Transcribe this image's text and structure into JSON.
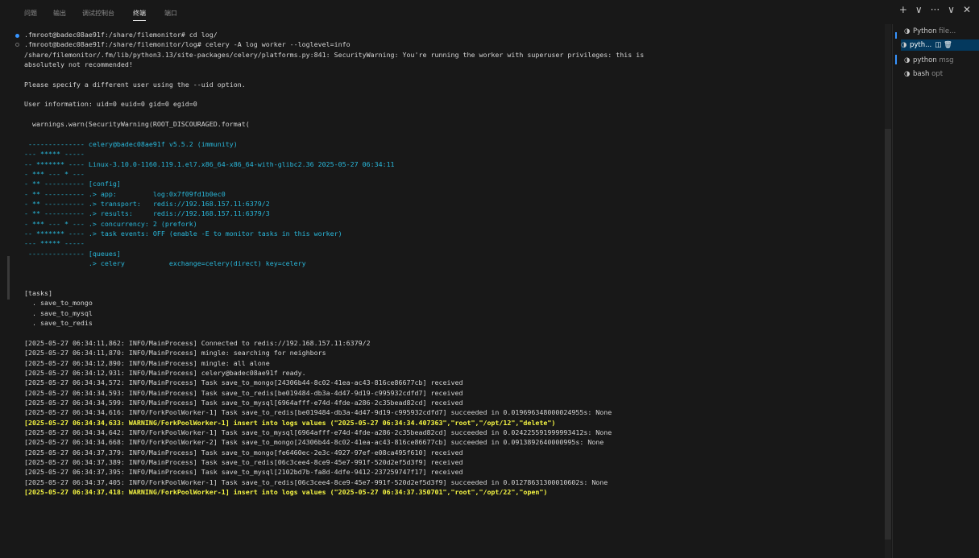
{
  "panel_tabs": [
    {
      "label": "问题"
    },
    {
      "label": "输出"
    },
    {
      "label": "调试控制台"
    },
    {
      "label": "终端"
    },
    {
      "label": "端口"
    }
  ],
  "actions": {
    "add": "+",
    "dropdown": "∨",
    "more": "···",
    "maximize": "∨",
    "close": "✕"
  },
  "terminal_lines": [
    {
      "text": ".fmroot@badec08ae91f:/share/filemonitor# cd log/",
      "style": "normal"
    },
    {
      "text": ".fmroot@badec08ae91f:/share/filemonitor/log# celery -A log worker --loglevel=info",
      "style": "normal"
    },
    {
      "text": "/share/filemonitor/.fm/lib/python3.13/site-packages/celery/platforms.py:841: SecurityWarning: You're running the worker with superuser privileges: this is",
      "style": "normal"
    },
    {
      "text": "absolutely not recommended!",
      "style": "normal"
    },
    {
      "text": "",
      "style": "normal"
    },
    {
      "text": "Please specify a different user using the --uid option.",
      "style": "normal"
    },
    {
      "text": "",
      "style": "normal"
    },
    {
      "text": "User information: uid=0 euid=0 gid=0 egid=0",
      "style": "normal"
    },
    {
      "text": "",
      "style": "normal"
    },
    {
      "text": "  warnings.warn(SecurityWarning(ROOT_DISCOURAGED.format(",
      "style": "normal"
    },
    {
      "text": "",
      "style": "normal"
    },
    {
      "text": " -------------- celery@badec08ae91f v5.5.2 (immunity)",
      "style": "cyan"
    },
    {
      "text": "--- ***** -----",
      "style": "cyan"
    },
    {
      "text": "-- ******* ---- Linux-3.10.0-1160.119.1.el7.x86_64-x86_64-with-glibc2.36 2025-05-27 06:34:11",
      "style": "cyan"
    },
    {
      "text": "- *** --- * ---",
      "style": "cyan"
    },
    {
      "text": "- ** ---------- [config]",
      "style": "cyan"
    },
    {
      "text": "- ** ---------- .> app:         log:0x7f09fd1b0ec0",
      "style": "cyan"
    },
    {
      "text": "- ** ---------- .> transport:   redis://192.168.157.11:6379/2",
      "style": "cyan"
    },
    {
      "text": "- ** ---------- .> results:     redis://192.168.157.11:6379/3",
      "style": "cyan"
    },
    {
      "text": "- *** --- * --- .> concurrency: 2 (prefork)",
      "style": "cyan"
    },
    {
      "text": "-- ******* ---- .> task events: OFF (enable -E to monitor tasks in this worker)",
      "style": "cyan"
    },
    {
      "text": "--- ***** -----",
      "style": "cyan"
    },
    {
      "text": " -------------- [queues]",
      "style": "cyan"
    },
    {
      "text": "                .> celery           exchange=celery(direct) key=celery",
      "style": "cyan"
    },
    {
      "text": "",
      "style": "normal"
    },
    {
      "text": "",
      "style": "normal"
    },
    {
      "text": "[tasks]",
      "style": "normal"
    },
    {
      "text": "  . save_to_mongo",
      "style": "normal"
    },
    {
      "text": "  . save_to_mysql",
      "style": "normal"
    },
    {
      "text": "  . save_to_redis",
      "style": "normal"
    },
    {
      "text": "",
      "style": "normal"
    },
    {
      "text": "[2025-05-27 06:34:11,862: INFO/MainProcess] Connected to redis://192.168.157.11:6379/2",
      "style": "normal"
    },
    {
      "text": "[2025-05-27 06:34:11,870: INFO/MainProcess] mingle: searching for neighbors",
      "style": "normal"
    },
    {
      "text": "[2025-05-27 06:34:12,890: INFO/MainProcess] mingle: all alone",
      "style": "normal"
    },
    {
      "text": "[2025-05-27 06:34:12,931: INFO/MainProcess] celery@badec08ae91f ready.",
      "style": "normal"
    },
    {
      "text": "[2025-05-27 06:34:34,572: INFO/MainProcess] Task save_to_mongo[24306b44-8c02-41ea-ac43-816ce86677cb] received",
      "style": "normal"
    },
    {
      "text": "[2025-05-27 06:34:34,593: INFO/MainProcess] Task save_to_redis[be019484-db3a-4d47-9d19-c995932cdfd7] received",
      "style": "normal"
    },
    {
      "text": "[2025-05-27 06:34:34,599: INFO/MainProcess] Task save_to_mysql[6964afff-e74d-4fde-a286-2c35bead82cd] received",
      "style": "normal"
    },
    {
      "text": "[2025-05-27 06:34:34,616: INFO/ForkPoolWorker-1] Task save_to_redis[be019484-db3a-4d47-9d19-c995932cdfd7] succeeded in 0.019696348000024955s: None",
      "style": "normal"
    },
    {
      "text": "[2025-05-27 06:34:34,633: WARNING/ForkPoolWorker-1] insert into logs values (\"2025-05-27 06:34:34.407363\",\"root\",\"/opt/12\",\"delete\")",
      "style": "yellow"
    },
    {
      "text": "[2025-05-27 06:34:34,642: INFO/ForkPoolWorker-1] Task save_to_mysql[6964afff-e74d-4fde-a286-2c35bead82cd] succeeded in 0.024225591999993412s: None",
      "style": "normal"
    },
    {
      "text": "[2025-05-27 06:34:34,668: INFO/ForkPoolWorker-2] Task save_to_mongo[24306b44-8c02-41ea-ac43-816ce86677cb] succeeded in 0.0913892640000995s: None",
      "style": "normal"
    },
    {
      "text": "[2025-05-27 06:34:37,379: INFO/MainProcess] Task save_to_mongo[fe6460ec-2e3c-4927-97ef-e08ca495f610] received",
      "style": "normal"
    },
    {
      "text": "[2025-05-27 06:34:37,389: INFO/MainProcess] Task save_to_redis[06c3cee4-8ce9-45e7-991f-520d2ef5d3f9] received",
      "style": "normal"
    },
    {
      "text": "[2025-05-27 06:34:37,395: INFO/MainProcess] Task save_to_mysql[2102bd7b-fa8d-4dfe-9412-237259747f17] received",
      "style": "normal"
    },
    {
      "text": "[2025-05-27 06:34:37,405: INFO/ForkPoolWorker-1] Task save_to_redis[06c3cee4-8ce9-45e7-991f-520d2ef5d3f9] succeeded in 0.01278631300010602s: None",
      "style": "normal"
    },
    {
      "text": "[2025-05-27 06:34:37,418: WARNING/ForkPoolWorker-1] insert into logs values (\"2025-05-27 06:34:37.350701\",\"root\",\"/opt/22\",\"open\")",
      "style": "yellow"
    }
  ],
  "terminal_sessions": [
    {
      "name": "Python",
      "desc": "file...",
      "active": false
    },
    {
      "name": "pyth...",
      "desc": "",
      "active": true,
      "tools": "◫ 🗑"
    },
    {
      "name": "python",
      "desc": "msg",
      "active": false
    },
    {
      "name": "bash",
      "desc": "opt",
      "active": false
    }
  ]
}
